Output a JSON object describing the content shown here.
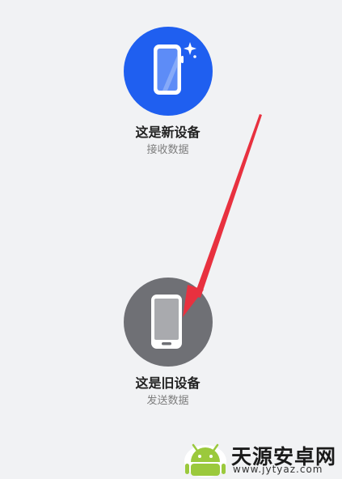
{
  "options": {
    "new_device": {
      "title": "这是新设备",
      "subtitle": "接收数据",
      "icon": "new-phone-icon",
      "color": "#1f5ff0"
    },
    "old_device": {
      "title": "这是旧设备",
      "subtitle": "发送数据",
      "icon": "old-phone-icon",
      "color": "#6f7075"
    }
  },
  "annotation": {
    "color": "#e8313f"
  },
  "watermark": {
    "title": "天源安卓网",
    "url": "www.jytyaz.com"
  }
}
